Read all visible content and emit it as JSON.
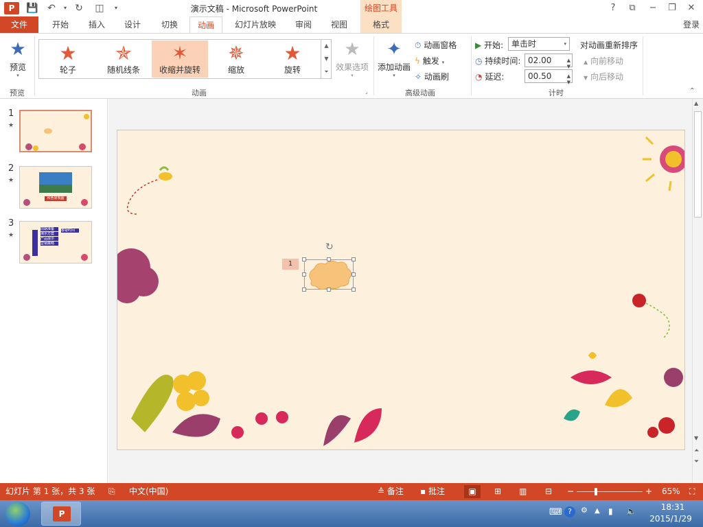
{
  "window": {
    "title": "演示文稿 - Microsoft PowerPoint",
    "context_tool": "绘图工具",
    "logo": "P"
  },
  "quick_access": {
    "save_icon": "save-icon",
    "undo_icon": "undo-icon",
    "redo_icon": "redo-icon",
    "present_icon": "present-icon"
  },
  "window_controls": {
    "help": "?",
    "restore_ribbon": "⧉",
    "minimize": "−",
    "maximize": "❐",
    "close": "✕"
  },
  "tabs": [
    "文件",
    "开始",
    "插入",
    "设计",
    "切换",
    "动画",
    "幻灯片放映",
    "审阅",
    "视图",
    "格式"
  ],
  "login": "登录",
  "ribbon": {
    "preview": {
      "label": "预览",
      "group": "预览"
    },
    "animation_gallery": {
      "group": "动画",
      "items": [
        {
          "label": "轮子",
          "icon": "wheel-star-icon"
        },
        {
          "label": "随机线条",
          "icon": "random-bars-star-icon"
        },
        {
          "label": "收缩并旋转",
          "icon": "shrink-turn-star-icon",
          "selected": true
        },
        {
          "label": "缩放",
          "icon": "zoom-star-icon"
        },
        {
          "label": "旋转",
          "icon": "swivel-star-icon"
        }
      ]
    },
    "effect_options": "效果选项",
    "advanced": {
      "group": "高级动画",
      "add_animation": "添加动画",
      "animation_pane": "动画窗格",
      "trigger": "触发",
      "animation_painter": "动画刷"
    },
    "timing": {
      "group": "计时",
      "start_label": "开始:",
      "start_value": "单击时",
      "duration_label": "持续时间:",
      "duration_value": "02.00",
      "delay_label": "延迟:",
      "delay_value": "00.50"
    },
    "reorder": {
      "title": "对动画重新排序",
      "move_earlier": "向前移动",
      "move_later": "向后移动"
    }
  },
  "slides": [
    {
      "number": "1",
      "anim_marker": "★",
      "selected": true
    },
    {
      "number": "2",
      "anim_marker": "★",
      "banner": "秋色景观图"
    },
    {
      "number": "3",
      "anim_marker": "★",
      "items": [
        "前期准备",
        "演示方案",
        "产品展示",
        "营销策略",
        "答疑时间"
      ]
    }
  ],
  "canvas": {
    "anim_tag": "1"
  },
  "statusbar": {
    "slide_info": "幻灯片 第 1 张，共 3 张",
    "language": "中文(中国)",
    "notes": "备注",
    "comments": "批注",
    "zoom": "65%"
  },
  "taskbar": {
    "time": "18:31",
    "date": "2015/1/29"
  },
  "colors": {
    "accent": "#d24726",
    "slide_bg": "#fdf0dc",
    "selected_gallery": "#fbd2b8",
    "context_tab": "#fbe0c4"
  }
}
